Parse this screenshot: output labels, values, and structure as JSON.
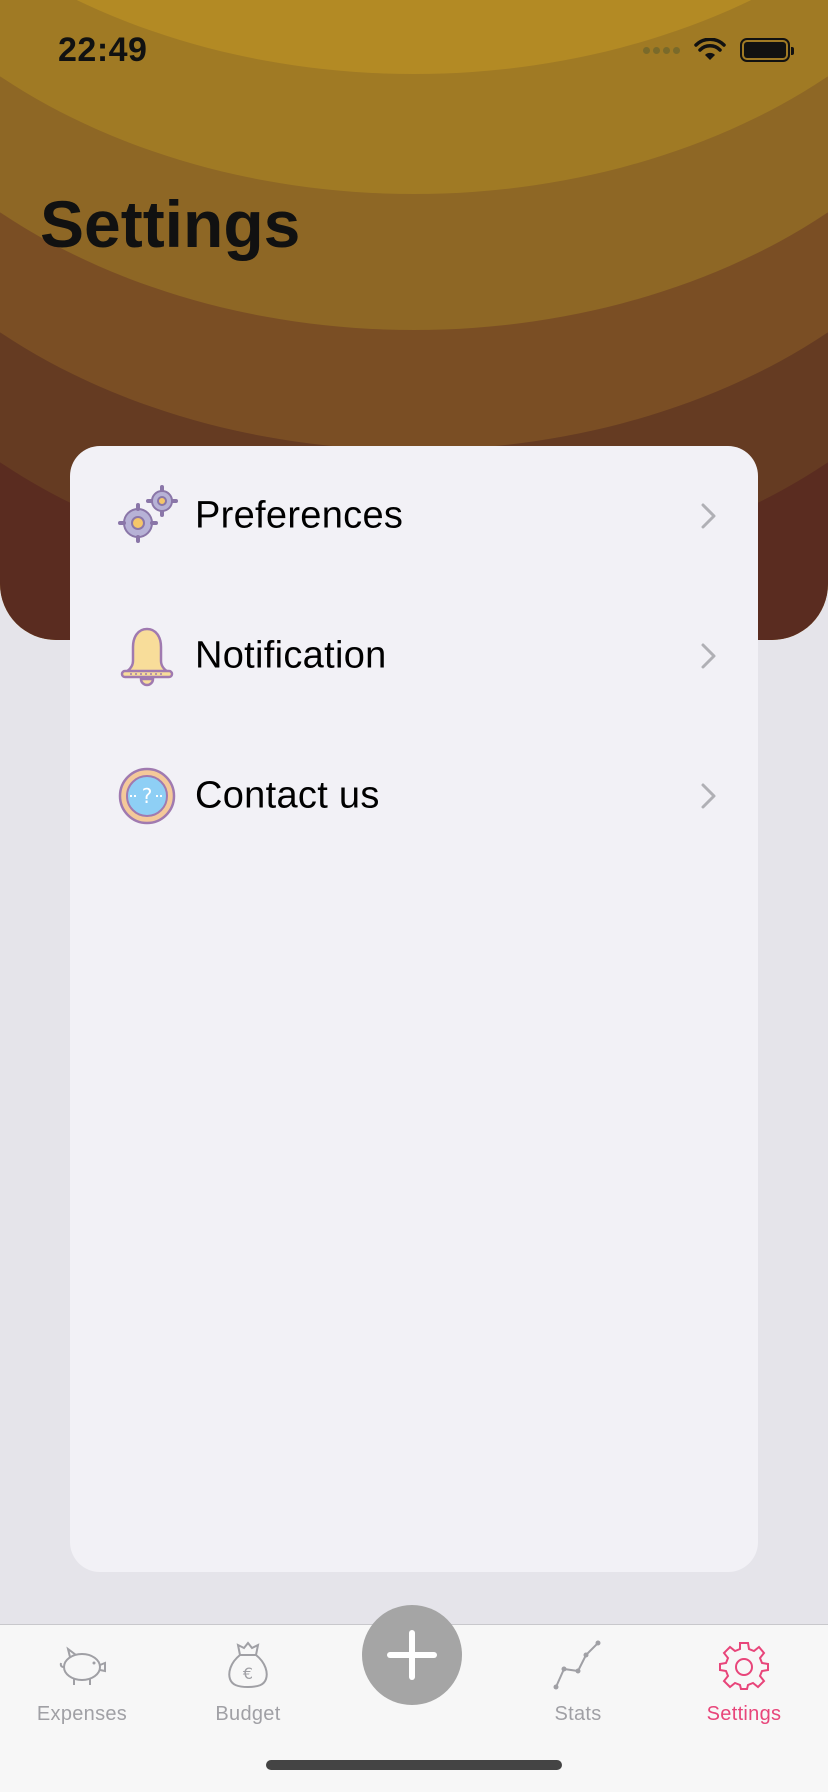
{
  "status_bar": {
    "time": "22:49"
  },
  "page": {
    "title": "Settings"
  },
  "settings_items": [
    {
      "label": "Preferences",
      "icon": "gears-icon"
    },
    {
      "label": "Notification",
      "icon": "bell-icon"
    },
    {
      "label": "Contact us",
      "icon": "help-icon"
    }
  ],
  "tab_bar": {
    "tabs": [
      {
        "label": "Expenses",
        "icon": "piggy-bank-icon"
      },
      {
        "label": "Budget",
        "icon": "money-bag-icon"
      },
      {
        "label": "Stats",
        "icon": "stats-icon"
      },
      {
        "label": "Settings",
        "icon": "gear-icon",
        "active": true
      }
    ],
    "add_icon": "plus-icon"
  },
  "colors": {
    "accent": "#e8457a",
    "header_top": "#b38a24",
    "header_bottom": "#5a2c20",
    "card": "#f2f1f6",
    "background": "#e5e4ea"
  }
}
